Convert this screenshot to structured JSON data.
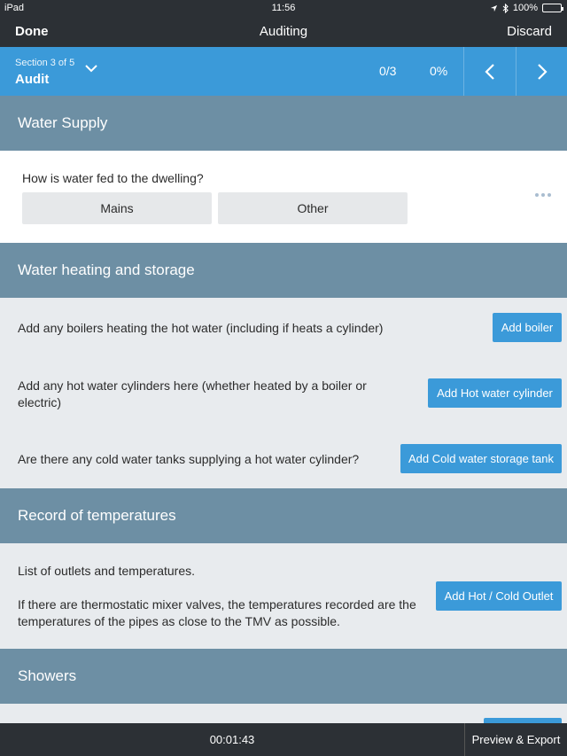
{
  "status_bar": {
    "device": "iPad",
    "time": "11:56",
    "battery": "100%",
    "location_icon": "location-arrow-icon",
    "bluetooth_icon": "bluetooth-icon"
  },
  "nav": {
    "done": "Done",
    "title": "Auditing",
    "discard": "Discard"
  },
  "section_bar": {
    "count": "Section 3 of 5",
    "name": "Audit",
    "progress": "0/3",
    "percent": "0%"
  },
  "water_supply": {
    "header": "Water Supply",
    "question": "How is water fed to the dwelling?",
    "options": [
      "Mains",
      "Other"
    ]
  },
  "water_heating": {
    "header": "Water heating and storage",
    "rows": [
      {
        "text": "Add any boilers heating the hot water (including if heats a cylinder)",
        "button": "Add boiler"
      },
      {
        "text": "Add any hot water cylinders here (whether heated by a boiler or electric)",
        "button": "Add Hot water cylinder"
      },
      {
        "text": "Are there any cold water tanks supplying a hot water cylinder?",
        "button": "Add Cold water storage tank"
      }
    ]
  },
  "temperatures": {
    "header": "Record of temperatures",
    "line1": "List of outlets and temperatures.",
    "line2": "If there are thermostatic mixer valves, the temperatures recorded are the temperatures of the pipes as close to the TMV as possible.",
    "button": "Add Hot / Cold Outlet"
  },
  "showers": {
    "header": "Showers"
  },
  "bottom_bar": {
    "timer": "00:01:43",
    "export": "Preview & Export"
  },
  "colors": {
    "accent": "#3b9ad9",
    "section_header": "#6d8fa4",
    "bar": "#2c3035"
  }
}
